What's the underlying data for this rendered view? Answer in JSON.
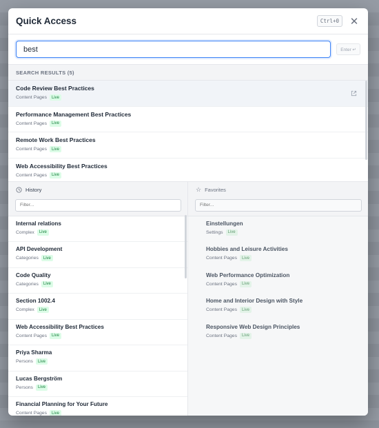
{
  "modal": {
    "title": "Quick Access",
    "shortcut": "Ctrl+0",
    "close_glyph": "✕"
  },
  "search": {
    "value": "best",
    "enter_label": "Enter ↵"
  },
  "results": {
    "label": "SEARCH RESULTS (5)",
    "items": [
      {
        "name": "Code Review Best Practices",
        "category": "Content Pages",
        "status": "Live"
      },
      {
        "name": "Performance Management Best Practices",
        "category": "Content Pages",
        "status": "Live"
      },
      {
        "name": "Remote Work Best Practices",
        "category": "Content Pages",
        "status": "Live"
      },
      {
        "name": "Web Accessibility Best Practices",
        "category": "Content Pages",
        "status": "Live"
      }
    ]
  },
  "history": {
    "label": "History",
    "icon": "clock-icon",
    "filter_placeholder": "Filter...",
    "items": [
      {
        "name": "Internal relations",
        "category": "Complex",
        "status": "Live"
      },
      {
        "name": "API Development",
        "category": "Categories",
        "status": "Live"
      },
      {
        "name": "Code Quality",
        "category": "Categories",
        "status": "Live"
      },
      {
        "name": "Section 1002.4",
        "category": "Complex",
        "status": "Live"
      },
      {
        "name": "Web Accessibility Best Practices",
        "category": "Content Pages",
        "status": "Live"
      },
      {
        "name": "Priya Sharma",
        "category": "Persons",
        "status": "Live"
      },
      {
        "name": "Lucas Bergström",
        "category": "Persons",
        "status": "Live"
      },
      {
        "name": "Financial Planning for Your Future",
        "category": "Content Pages",
        "status": "Live"
      }
    ]
  },
  "favorites": {
    "label": "Favorites",
    "icon": "star-icon",
    "filter_placeholder": "Filter...",
    "items": [
      {
        "name": "Einstellungen",
        "category": "Settings",
        "status": "Live"
      },
      {
        "name": "Hobbies and Leisure Activities",
        "category": "Content Pages",
        "status": "Live"
      },
      {
        "name": "Web Performance Optimization",
        "category": "Content Pages",
        "status": "Live"
      },
      {
        "name": "Home and Interior Design with Style",
        "category": "Content Pages",
        "status": "Live"
      },
      {
        "name": "Responsive Web Design Principles",
        "category": "Content Pages",
        "status": "Live"
      }
    ]
  },
  "colors": {
    "accent": "#3b82f6",
    "live_badge_bg": "#dcfce7",
    "live_badge_text": "#16803c"
  }
}
